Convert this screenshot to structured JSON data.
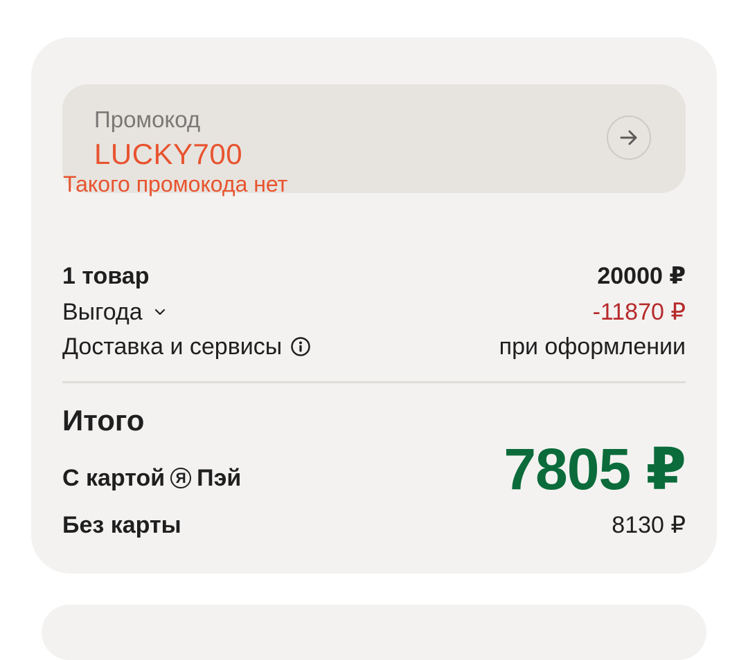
{
  "promo": {
    "label": "Промокод",
    "value": "LUCKY700",
    "error": "Такого промокода нет",
    "apply_icon": "arrow-right-icon"
  },
  "summary": {
    "items_label": "1 товар",
    "items_value": "20000 ₽",
    "benefit_label": "Выгода",
    "benefit_value": "-11870 ₽",
    "delivery_label": "Доставка и сервисы",
    "delivery_value": "при оформлении"
  },
  "total": {
    "title": "Итого",
    "with_card_label": "С картой",
    "pay_badge": "Я",
    "pay_name": "Пэй",
    "with_card_price": "7805 ₽",
    "no_card_label": "Без карты",
    "no_card_price": "8130 ₽"
  },
  "colors": {
    "accent_error": "#e8532f",
    "discount": "#b72a2a",
    "total_price": "#0b6b3a"
  }
}
